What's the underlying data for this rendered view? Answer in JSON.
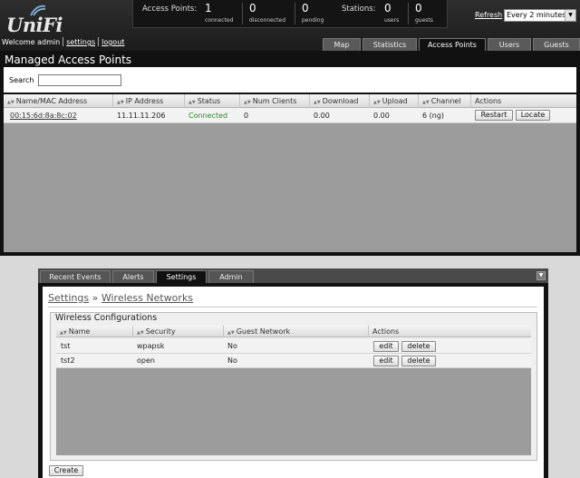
{
  "app": {
    "logo_text": "UniFi"
  },
  "stats": {
    "access_points_label": "Access Points:",
    "connected": {
      "value": "1",
      "label": "connected"
    },
    "disconnected": {
      "value": "0",
      "label": "disconnected"
    },
    "pending": {
      "value": "0",
      "label": "pending"
    },
    "stations_label": "Stations:",
    "users": {
      "value": "0",
      "label": "users"
    },
    "guests": {
      "value": "0",
      "label": "guests"
    }
  },
  "refresh": {
    "label": "Refresh",
    "selected": "Every 2 minutes"
  },
  "user_bar": {
    "welcome": "Welcome admin",
    "settings": "settings",
    "logout": "logout"
  },
  "main_tabs": [
    {
      "label": "Map"
    },
    {
      "label": "Statistics"
    },
    {
      "label": "Access Points",
      "active": true
    },
    {
      "label": "Users"
    },
    {
      "label": "Guests"
    }
  ],
  "managed_aps": {
    "title": "Managed Access Points",
    "search_label": "Search",
    "search_value": "",
    "columns": [
      "Name/MAC Address",
      "IP Address",
      "Status",
      "Num Clients",
      "Download",
      "Upload",
      "Channel",
      "Actions"
    ],
    "rows": [
      {
        "name": "00:15:6d:8a:8c:02",
        "ip": "11.11.11.206",
        "status": "Connected",
        "clients": "0",
        "download": "0.00",
        "upload": "0.00",
        "channel": "6 (ng)",
        "actions": [
          "Restart",
          "Locate"
        ]
      }
    ]
  },
  "bottom_tabs": [
    {
      "label": "Recent Events"
    },
    {
      "label": "Alerts"
    },
    {
      "label": "Settings",
      "active": true
    },
    {
      "label": "Admin"
    }
  ],
  "settings_panel": {
    "breadcrumb_root": "Settings",
    "breadcrumb_sep": " » ",
    "breadcrumb_current": "Wireless Networks",
    "section_title": "Wireless Configurations",
    "columns": [
      "Name",
      "Security",
      "Guest Network",
      "Actions"
    ],
    "rows": [
      {
        "name": "tst",
        "security": "wpapsk",
        "guest": "No",
        "actions": [
          "edit",
          "delete"
        ]
      },
      {
        "name": "tst2",
        "security": "open",
        "guest": "No",
        "actions": [
          "edit",
          "delete"
        ]
      }
    ],
    "create_label": "Create"
  },
  "icons": {
    "collapse": "collapse-icon",
    "sort": "sort-arrows-icon",
    "dropdown": "chevron-down-icon"
  },
  "colors": {
    "header": "#1c1c1c",
    "status_connected": "#2a8a2a",
    "grid_fill": "#9c9c9c",
    "panel_dark": "#111111"
  }
}
